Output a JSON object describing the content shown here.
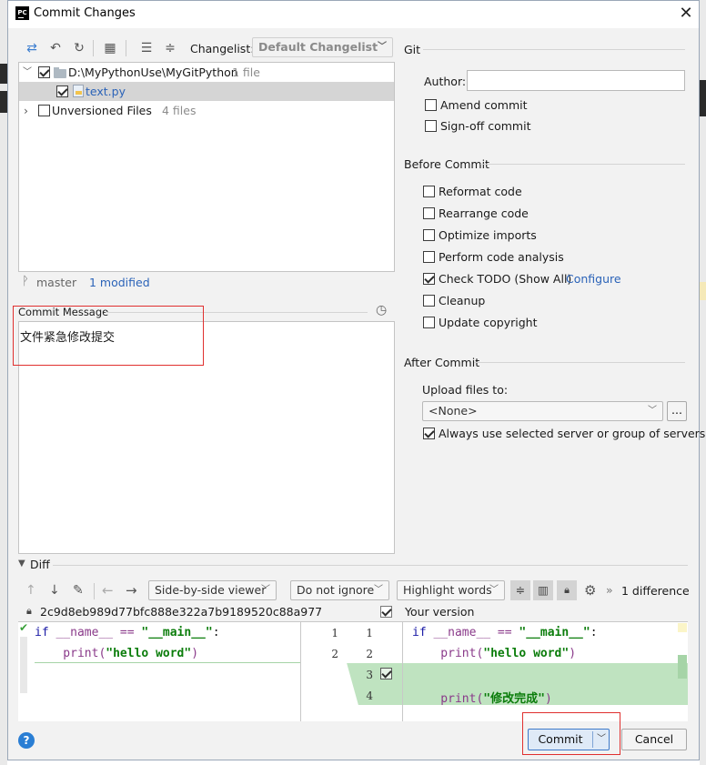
{
  "window": {
    "title": "Commit Changes"
  },
  "toolbar": {
    "changelist_label": "Changelist:",
    "changelist_value": "Default Changelist"
  },
  "tree": {
    "root_path": "D:\\MyPythonUse\\MyGitPython",
    "root_count": "1 file",
    "file_name": "text.py",
    "unversioned_label": "Unversioned Files",
    "unversioned_count": "4 files"
  },
  "status": {
    "branch": "master",
    "modified": "1 modified"
  },
  "commit_message": {
    "label": "Commit Message",
    "text": "文件紧急修改提交"
  },
  "git": {
    "section": "Git",
    "author_label": "Author:",
    "author_value": "",
    "amend": "Amend commit",
    "signoff": "Sign-off commit"
  },
  "before_commit": {
    "section": "Before Commit",
    "reformat": "Reformat code",
    "rearrange": "Rearrange code",
    "optimize": "Optimize imports",
    "analysis": "Perform code analysis",
    "todo": "Check TODO (Show All)",
    "configure": "Configure",
    "cleanup": "Cleanup",
    "copyright": "Update copyright"
  },
  "after_commit": {
    "section": "After Commit",
    "upload_label": "Upload files to:",
    "upload_value": "<None>",
    "browse": "...",
    "always_use": "Always use selected server or group of servers"
  },
  "diff": {
    "section": "Diff",
    "viewer": "Side-by-side viewer",
    "ignore": "Do not ignore",
    "highlight": "Highlight words",
    "differences": "1 difference",
    "left_hash": "2c9d8eb989d77bfc888e322a7b9189520c88a977",
    "right_title": "Your version",
    "left_lines": [
      {
        "num": "1",
        "code_kw": "if",
        "code_mid": " __name__ == ",
        "code_str": "\"__main__\"",
        "code_end": ":"
      },
      {
        "num": "2",
        "code_kw": "",
        "code_mid": "    print(",
        "code_str": "\"hello word\"",
        "code_end": ")"
      }
    ],
    "right_nums": [
      "1",
      "2",
      "3",
      "4"
    ],
    "right_lines": [
      {
        "code_kw": "if",
        "code_mid": " __name__ == ",
        "code_str": "\"__main__\"",
        "code_end": ":"
      },
      {
        "code_kw": "",
        "code_mid": "    print(",
        "code_str": "\"hello word\"",
        "code_end": ")"
      },
      {
        "code_kw": "",
        "code_mid": "",
        "code_str": "",
        "code_end": ""
      },
      {
        "code_kw": "",
        "code_mid": "    print(",
        "code_str": "\"修改完成\"",
        "code_end": ")"
      }
    ]
  },
  "buttons": {
    "commit": "Commit",
    "cancel": "Cancel",
    "help": "?"
  },
  "colors": {
    "accent": "#2b63b8",
    "added": "#bfe3c0",
    "highlight_border": "#e0302f"
  }
}
